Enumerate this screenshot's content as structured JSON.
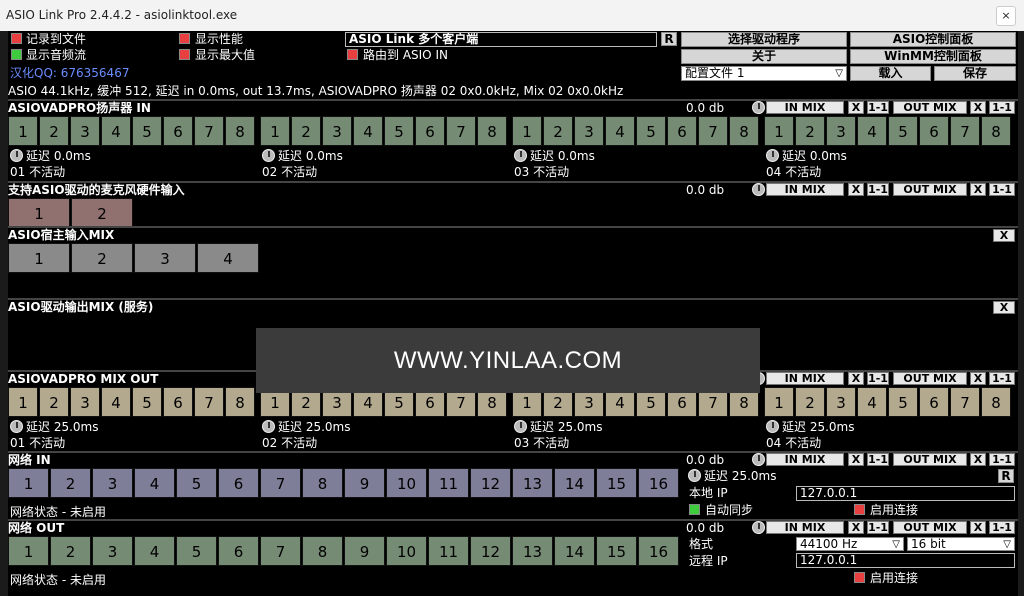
{
  "window": {
    "title": "ASIO Link Pro 2.4.4.2 - asiolinktool.exe",
    "close": "×"
  },
  "options": {
    "record_to_file": "记录到文件",
    "show_performance": "显示性能",
    "show_audio_flow": "显示音频流",
    "show_max": "显示最大值",
    "route_to_asio_in": "路由到 ASIO IN",
    "multi_client": "ASIO Link 多个客户端",
    "r_badge": "R",
    "translator": "汉化QQ: 676356467"
  },
  "buttons": {
    "select_driver": "选择驱动程序",
    "asio_control_panel": "ASIO控制面板",
    "about": "关于",
    "winmm_control_panel": "WinMM控制面板",
    "config_file": "配置文件 1",
    "load": "载入",
    "save": "保存"
  },
  "status_line": "ASIO 44.1kHz, 缓冲 512, 延迟 in 0.0ms, out 13.7ms, ASIOVADPRO 扬声器 02 0x0.0kHz, Mix 02 0x0.0kHz",
  "mix": {
    "in_mix": "IN MIX",
    "x": "X",
    "one_to_one": "1-1",
    "out_mix": "OUT MIX",
    "close": "X"
  },
  "sections": {
    "speaker": {
      "title": "ASIOVADPRO扬声器 IN",
      "level": "0.0 db",
      "groups": [
        {
          "delay": "延迟 0.0ms",
          "status": "01 不活动"
        },
        {
          "delay": "延迟 0.0ms",
          "status": "02 不活动"
        },
        {
          "delay": "延迟 0.0ms",
          "status": "03 不活动"
        },
        {
          "delay": "延迟 0.0ms",
          "status": "04 不活动"
        }
      ],
      "channels": [
        "1",
        "2",
        "3",
        "4",
        "5",
        "6",
        "7",
        "8"
      ]
    },
    "mic": {
      "title": "支持ASIO驱动的麦克风硬件输入",
      "level": "0.0 db",
      "channels": [
        "1",
        "2"
      ]
    },
    "host_mix": {
      "title": "ASIO宿主输入MIX",
      "channels": [
        "1",
        "2",
        "3",
        "4"
      ]
    },
    "driver_out": {
      "title": "ASIO驱动输出MIX (服务)"
    },
    "mix_out": {
      "title": "ASIOVADPRO MIX OUT",
      "groups": [
        {
          "delay": "延迟 25.0ms",
          "status": "01 不活动"
        },
        {
          "delay": "延迟 25.0ms",
          "status": "02 不活动"
        },
        {
          "delay": "延迟 25.0ms",
          "status": "03 不活动"
        },
        {
          "delay": "延迟 25.0ms",
          "status": "04 不活动"
        }
      ],
      "channels": [
        "1",
        "2",
        "3",
        "4",
        "5",
        "6",
        "7",
        "8"
      ]
    },
    "net_in": {
      "title": "网络 IN",
      "level": "0.0 db",
      "channels": [
        "1",
        "2",
        "3",
        "4",
        "5",
        "6",
        "7",
        "8",
        "9",
        "10",
        "11",
        "12",
        "13",
        "14",
        "15",
        "16"
      ],
      "status": "网络状态 - 未启用",
      "delay": "延迟 25.0ms",
      "local_ip_label": "本地 IP",
      "local_ip": "127.0.0.1",
      "auto_sync": "自动同步",
      "enable_connect": "启用连接"
    },
    "net_out": {
      "title": "网络 OUT",
      "level": "0.0 db",
      "channels": [
        "1",
        "2",
        "3",
        "4",
        "5",
        "6",
        "7",
        "8",
        "9",
        "10",
        "11",
        "12",
        "13",
        "14",
        "15",
        "16"
      ],
      "status": "网络状态 - 未启用",
      "format_label": "格式",
      "sample_rate": "44100 Hz",
      "bit_depth": "16 bit",
      "remote_ip_label": "远程 IP",
      "remote_ip": "127.0.0.1",
      "enable_connect": "启用连接"
    }
  },
  "watermark": "WWW.YINLAA.COM"
}
